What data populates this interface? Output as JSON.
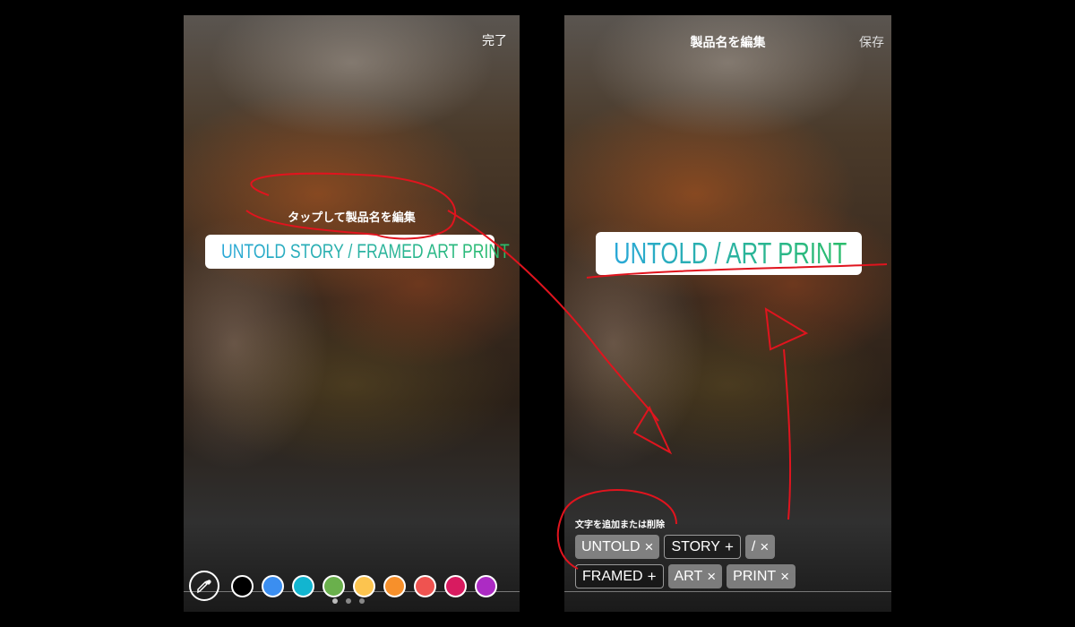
{
  "left_screen": {
    "done_label": "完了",
    "hint": "タップして製品名を編集",
    "sticker_text": "UNTOLD STORY / FRAMED ART PRINT",
    "sticker_icon": "shopping-bag-icon",
    "color_swatches": [
      "#000000",
      "#3b8ef0",
      "#12b5d0",
      "#6ab04c",
      "#fcc44f",
      "#f7902b",
      "#ef5350",
      "#d81b60",
      "#ac2bc4"
    ],
    "page_indicator": {
      "count": 3,
      "active": 0
    }
  },
  "right_screen": {
    "title": "製品名を編集",
    "save_label": "保存",
    "sticker_text": "UNTOLD / ART PRINT",
    "sticker_icon": "shopping-bag-icon",
    "tags_title": "文字を追加または削除",
    "tags": [
      {
        "label": "UNTOLD",
        "selected": true,
        "action": "×"
      },
      {
        "label": "STORY",
        "selected": false,
        "action": "+"
      },
      {
        "label": "/",
        "selected": true,
        "action": "×"
      },
      {
        "label": "FRAMED",
        "selected": false,
        "action": "+"
      },
      {
        "label": "ART",
        "selected": true,
        "action": "×"
      },
      {
        "label": "PRINT",
        "selected": true,
        "action": "×"
      }
    ]
  },
  "colors": {
    "annotation": "#e0141e",
    "sticker_gradient": [
      "#2aa8d8",
      "#2bbd6a"
    ]
  }
}
